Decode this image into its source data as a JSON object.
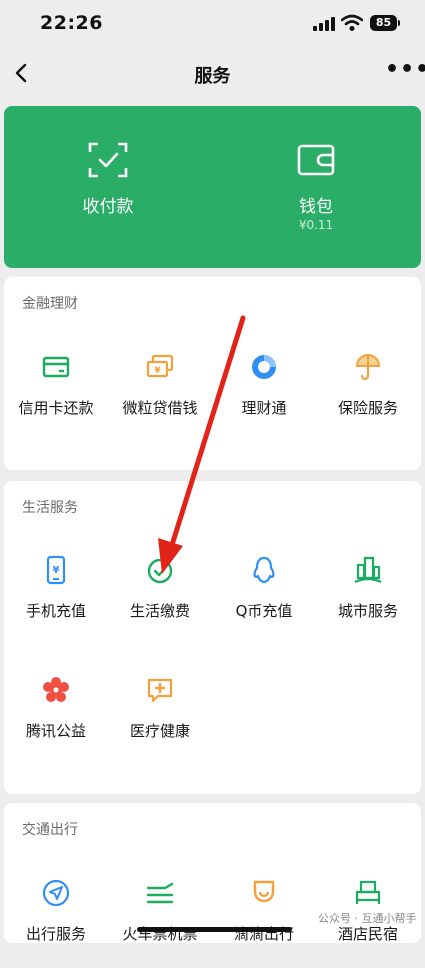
{
  "status_bar": {
    "time": "22:26",
    "battery": "85"
  },
  "nav": {
    "title": "服务"
  },
  "wallet": [
    {
      "label": "收付款",
      "icon": "scan-pay-icon"
    },
    {
      "label": "钱包",
      "sub": "¥0.11",
      "icon": "wallet-icon"
    }
  ],
  "sections": {
    "finance": {
      "title": "金融理财",
      "items": [
        {
          "label": "信用卡还款",
          "icon": "credit-card-icon"
        },
        {
          "label": "微粒贷借钱",
          "icon": "loan-icon"
        },
        {
          "label": "理财通",
          "icon": "wealth-icon"
        },
        {
          "label": "保险服务",
          "icon": "insurance-icon"
        }
      ]
    },
    "life": {
      "title": "生活服务",
      "items": [
        {
          "label": "手机充值",
          "icon": "phone-topup-icon"
        },
        {
          "label": "生活缴费",
          "icon": "bill-pay-icon"
        },
        {
          "label": "Q币充值",
          "icon": "qq-coin-icon"
        },
        {
          "label": "城市服务",
          "icon": "city-service-icon"
        },
        {
          "label": "腾讯公益",
          "icon": "charity-icon"
        },
        {
          "label": "医疗健康",
          "icon": "medical-icon"
        }
      ]
    },
    "transport": {
      "title": "交通出行",
      "items": [
        {
          "label": "出行服务",
          "icon": "travel-icon"
        },
        {
          "label": "火车票机票",
          "icon": "train-ticket-icon"
        },
        {
          "label": "滴滴出行",
          "icon": "didi-icon"
        },
        {
          "label": "酒店民宿",
          "icon": "hotel-icon"
        }
      ]
    }
  },
  "watermark": "公众号 · 互通小帮手",
  "colors": {
    "brand_green": "#2aae67",
    "icon_green": "#1aad5f",
    "icon_orange": "#f2a23a",
    "icon_blue": "#2f8ff5",
    "icon_red": "#f04f43",
    "arrow_red": "#e2231a"
  }
}
